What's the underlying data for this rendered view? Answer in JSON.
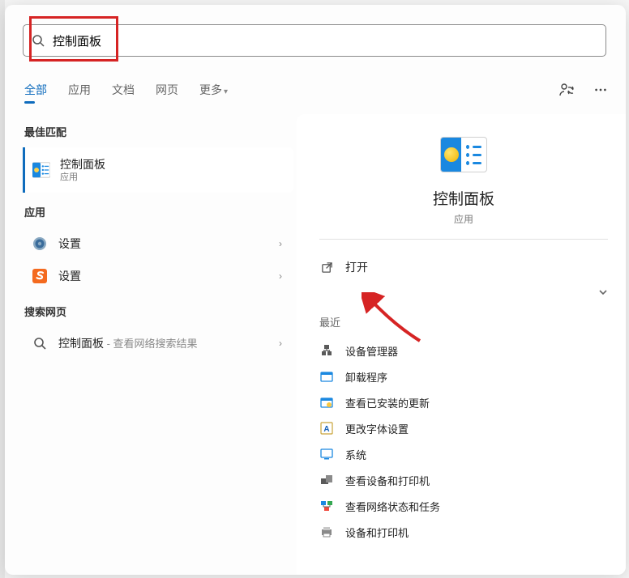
{
  "search": {
    "value": "控制面板",
    "placeholder": ""
  },
  "tabs": {
    "items": [
      "全部",
      "应用",
      "文档",
      "网页",
      "更多"
    ],
    "active_index": 0
  },
  "left": {
    "best_match_header": "最佳匹配",
    "best_match": {
      "label": "控制面板",
      "sub": "应用"
    },
    "apps_header": "应用",
    "apps": [
      {
        "label": "设置"
      },
      {
        "label": "设置"
      }
    ],
    "web_header": "搜索网页",
    "web": {
      "label": "控制面板",
      "suffix": " - 查看网络搜索结果"
    }
  },
  "right": {
    "title": "控制面板",
    "sub": "应用",
    "open_label": "打开",
    "recent_header": "最近",
    "recent": [
      "设备管理器",
      "卸载程序",
      "查看已安装的更新",
      "更改字体设置",
      "系统",
      "查看设备和打印机",
      "查看网络状态和任务",
      "设备和打印机"
    ]
  }
}
